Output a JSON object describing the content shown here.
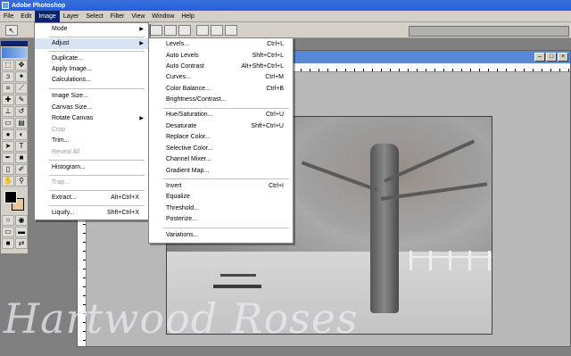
{
  "window": {
    "title": "Adobe Photoshop"
  },
  "menubar": [
    "File",
    "Edit",
    "Image",
    "Layer",
    "Select",
    "Filter",
    "View",
    "Window",
    "Help"
  ],
  "image_menu": [
    {
      "label": "Mode",
      "submenu": true
    },
    {
      "label": "Adjust",
      "submenu": true,
      "highlighted": true
    },
    {
      "label": "Duplicate..."
    },
    {
      "label": "Apply Image..."
    },
    {
      "label": "Calculations..."
    },
    {
      "label": "Image Size..."
    },
    {
      "label": "Canvas Size..."
    },
    {
      "label": "Rotate Canvas",
      "submenu": true
    },
    {
      "label": "Crop",
      "disabled": true
    },
    {
      "label": "Trim..."
    },
    {
      "label": "Reveal All",
      "disabled": true
    },
    {
      "label": "Histogram..."
    },
    {
      "label": "Trap...",
      "disabled": true
    },
    {
      "label": "Extract...",
      "shortcut": "Alt+Ctrl+X"
    },
    {
      "label": "Liquify...",
      "shortcut": "Shft+Ctrl+X"
    }
  ],
  "adjust_menu": [
    {
      "label": "Levels...",
      "shortcut": "Ctrl+L"
    },
    {
      "label": "Auto Levels",
      "shortcut": "Shft+Ctrl+L"
    },
    {
      "label": "Auto Contrast",
      "shortcut": "Alt+Shft+Ctrl+L"
    },
    {
      "label": "Curves...",
      "shortcut": "Ctrl+M"
    },
    {
      "label": "Color Balance...",
      "shortcut": "Ctrl+B"
    },
    {
      "label": "Brightness/Contrast..."
    },
    {
      "label": "Hue/Saturation...",
      "shortcut": "Ctrl+U"
    },
    {
      "label": "Desaturate",
      "shortcut": "Shft+Ctrl+U"
    },
    {
      "label": "Replace Color..."
    },
    {
      "label": "Selective Color..."
    },
    {
      "label": "Channel Mixer..."
    },
    {
      "label": "Gradient Map..."
    },
    {
      "label": "Invert",
      "shortcut": "Ctrl+I"
    },
    {
      "label": "Equalize"
    },
    {
      "label": "Threshold..."
    },
    {
      "label": "Posterize..."
    },
    {
      "label": "Variations..."
    }
  ],
  "watermark": "Hartwood Roses",
  "colors": {
    "foreground": "#000000",
    "background": "#e8c89a",
    "menu_highlight": "#d8e4f6"
  }
}
